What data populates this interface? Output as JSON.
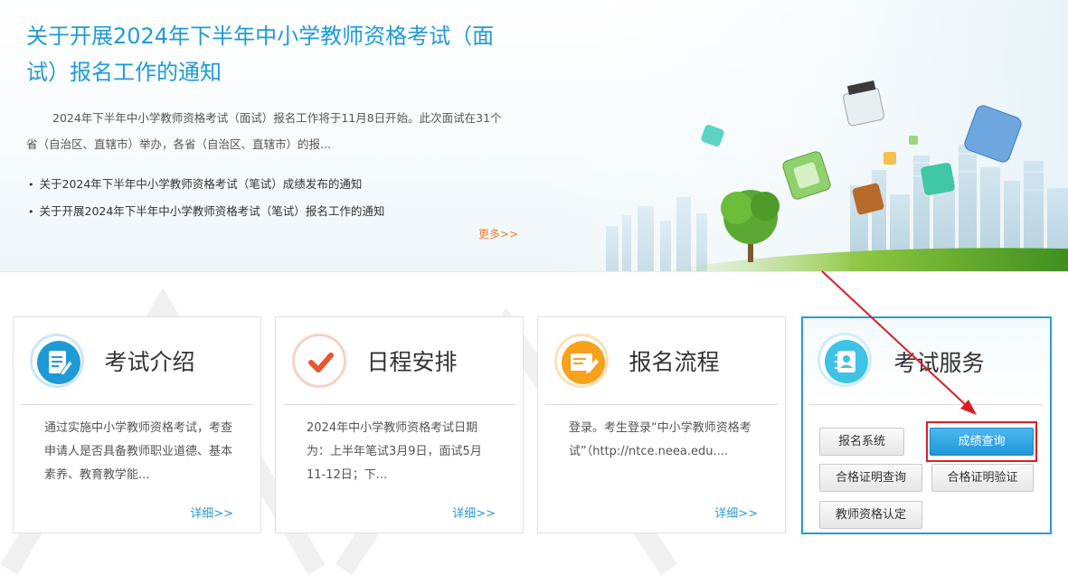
{
  "news": {
    "title": "关于开展2024年下半年中小学教师资格考试（面试）报名工作的通知",
    "summary": "2024年下半年中小学教师资格考试（面试）报名工作将于11月8日开始。此次面试在31个省（自治区、直辖市）举办，各省（自治区、直辖市）的报...",
    "links": [
      "关于2024年下半年中小学教师资格考试（笔试）成绩发布的通知",
      "关于开展2024年下半年中小学教师资格考试（笔试）报名工作的通知"
    ],
    "more": "更多>>"
  },
  "cards": [
    {
      "title": "考试介绍",
      "icon": "document-edit-icon",
      "text": "通过实施中小学教师资格考试，考查申请人是否具备教师职业道德、基本素养、教育教学能...",
      "more": "详细>>"
    },
    {
      "title": "日程安排",
      "icon": "checkmark-icon",
      "text": "2024年中小学教师资格考试日期为：上半年笔试3月9日，面试5月11-12日；下...",
      "more": "详细>>"
    },
    {
      "title": "报名流程",
      "icon": "form-pen-icon",
      "text": "登录。考生登录“中小学教师资格考试”（http://ntce.neea.edu....",
      "more": "详细>>"
    }
  ],
  "service": {
    "title": "考试服务",
    "icon": "contact-book-icon",
    "buttons": [
      "报名系统",
      "成绩查询",
      "合格证明查询",
      "合格证明验证",
      "教师资格认定"
    ]
  },
  "colors": {
    "accent": "#1e9bd7",
    "more_orange": "#ef7d2a",
    "highlight_red": "#d91f26",
    "primary_button": "#2a9ad6"
  }
}
